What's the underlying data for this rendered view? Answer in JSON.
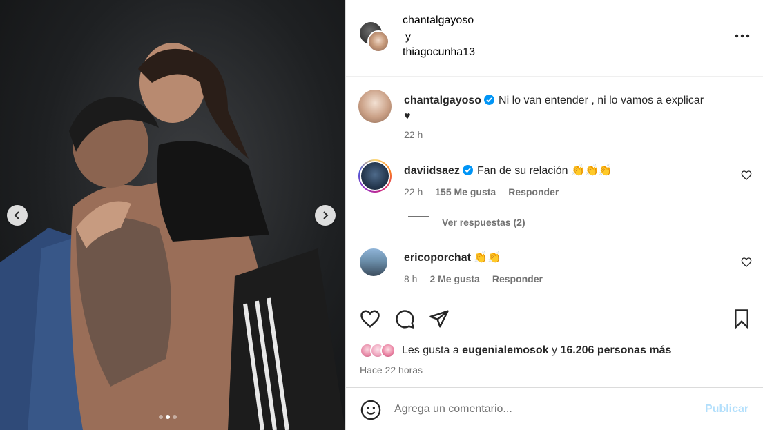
{
  "media": {
    "carousel_dots": 3,
    "active_dot_index": 1,
    "prev_icon": "chevron-left-icon",
    "next_icon": "chevron-right-icon"
  },
  "header": {
    "author1": "chantalgayoso",
    "conjunction": "y",
    "author2": "thiagocunha13",
    "more_icon": "more-options-icon"
  },
  "caption": {
    "username": "chantalgayoso",
    "text": "Ni lo van entender , ni lo vamos a explicar",
    "text_line2": "♥",
    "time": "22 h"
  },
  "comments": [
    {
      "username": "daviidsaez",
      "text": "Fan de su relación 👏👏👏",
      "time": "22 h",
      "likes": "155 Me gusta",
      "reply": "Responder",
      "view_replies": "Ver respuestas (2)"
    },
    {
      "username": "ericoporchat",
      "text": "👏👏",
      "time": "8 h",
      "likes": "2 Me gusta",
      "reply": "Responder"
    }
  ],
  "likes": {
    "prefix": "Les gusta a ",
    "user": "eugenialemosok",
    "suffix": " y ",
    "count": "16.206 personas más",
    "time": "Hace 22 horas"
  },
  "add_comment": {
    "placeholder": "Agrega un comentario...",
    "publish_label": "Publicar"
  },
  "colors": {
    "verified": "#0095f6",
    "publish_disabled": "#b2dffc",
    "muted_text": "#737373"
  }
}
